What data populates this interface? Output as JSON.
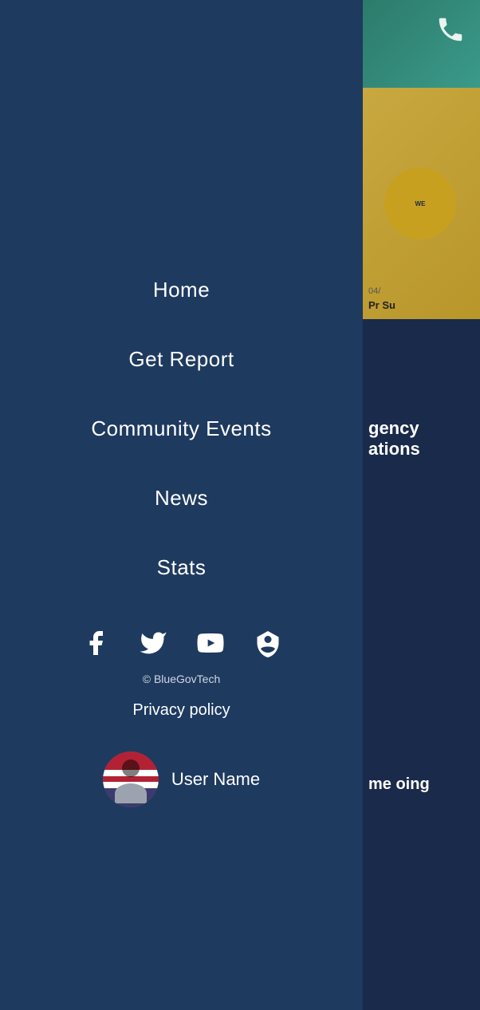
{
  "sidebar": {
    "background_color": "#1e3a5f",
    "nav": {
      "items": [
        {
          "id": "home",
          "label": "Home",
          "url": "#"
        },
        {
          "id": "get-report",
          "label": "Get Report",
          "url": "#"
        },
        {
          "id": "community-events",
          "label": "Community Events",
          "url": "#"
        },
        {
          "id": "news",
          "label": "News",
          "url": "#"
        },
        {
          "id": "stats",
          "label": "Stats",
          "url": "#"
        }
      ]
    },
    "social": {
      "items": [
        {
          "id": "facebook",
          "icon": "facebook-icon"
        },
        {
          "id": "twitter",
          "icon": "twitter-icon"
        },
        {
          "id": "youtube",
          "icon": "youtube-icon"
        },
        {
          "id": "badge",
          "icon": "badge-icon"
        }
      ]
    },
    "copyright": "© BlueGovTech",
    "privacy_label": "Privacy policy",
    "user": {
      "name": "User Name"
    }
  },
  "right_panel": {
    "date_text": "04/",
    "article_title_partial": "Pr Su",
    "partial_text_1": "gency ations",
    "partial_text_2": "me oing"
  },
  "phone_icon": "phone-icon"
}
